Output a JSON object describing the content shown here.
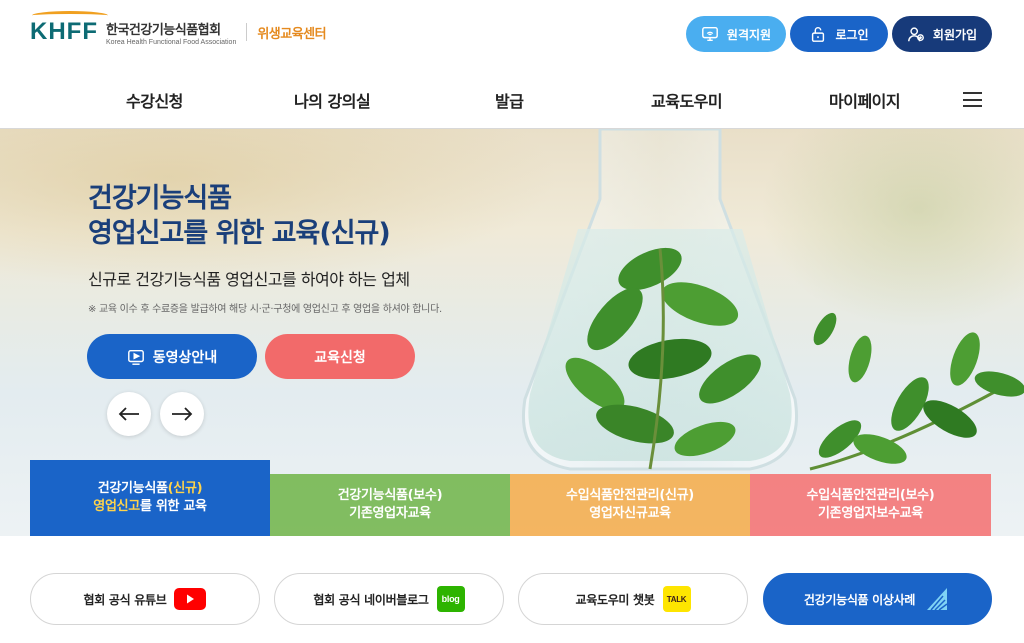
{
  "header": {
    "logo_mark": "KHFF",
    "logo_kr": "한국건강기능식품협회",
    "logo_en": "Korea Health Functional Food Association",
    "center_name": "위생교육센터",
    "buttons": {
      "remote": "원격지원",
      "login": "로그인",
      "join": "회원가입"
    }
  },
  "nav": {
    "items": [
      "수강신청",
      "나의 강의실",
      "발급",
      "교육도우미",
      "마이페이지"
    ]
  },
  "hero": {
    "title_line1": "건강기능식품",
    "title_line2": "영업신고를 위한 교육(신규)",
    "subtitle": "신규로 건강기능식품 영업신고를 하여야 하는 업체",
    "note": "※ 교육 이수 후 수료증을 발급하여 해당 시·군·구청에 영업신고 후 영업을 하셔야 합니다.",
    "video_button": "동영상안내",
    "apply_button": "교육신청"
  },
  "tabs": [
    {
      "pre": "건강기능식품",
      "highlight": "(신규)",
      "line2_hl": "영업신고",
      "line2": "를 위한 교육"
    },
    {
      "line1": "건강기능식품(보수)",
      "line2": "기존영업자교육"
    },
    {
      "line1": "수입식품안전관리(신규)",
      "line2": "영업자신규교육"
    },
    {
      "line1": "수입식품안전관리(보수)",
      "line2": "기존영업자보수교육"
    }
  ],
  "quick_links": {
    "youtube": "협회 공식 유튜브",
    "blog": "협회 공식 네이버블로그",
    "blog_badge": "blog",
    "chatbot": "교육도우미 챗봇",
    "talk_badge": "TALK",
    "cases": "건강기능식품 이상사례"
  },
  "colors": {
    "primary": "#1a64c8",
    "navy": "#173a7a",
    "sky": "#4aaef0",
    "coral": "#f26a6a",
    "green": "#6eb446",
    "orange": "#f5aa46",
    "red": "#f56e6e",
    "brand_teal": "#0d6b74",
    "brand_orange": "#e58a1f"
  }
}
